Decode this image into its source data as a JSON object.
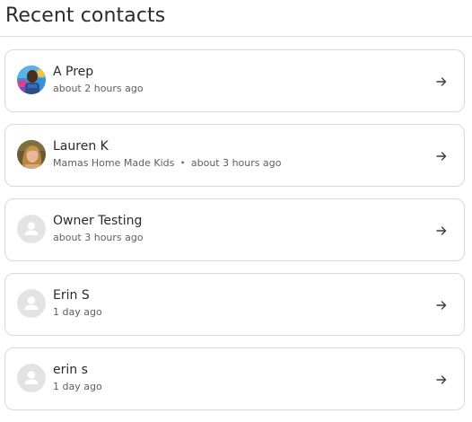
{
  "header": {
    "title": "Recent contacts"
  },
  "contacts": [
    {
      "name": "A Prep",
      "time": "about 2 hours ago",
      "avatar": "photo-avatar-man"
    },
    {
      "name": "Lauren K",
      "company": "Mamas Home Made Kids",
      "separator": "•",
      "time": "about 3 hours ago",
      "avatar": "photo-avatar-woman"
    },
    {
      "name": "Owner Testing",
      "time": "about 3 hours ago",
      "avatar": "default-user-icon"
    },
    {
      "name": "Erin S",
      "time": "1 day ago",
      "avatar": "default-user-icon"
    },
    {
      "name": "erin s",
      "time": "1 day ago",
      "avatar": "default-user-icon"
    }
  ],
  "icons": {
    "row_action": "arrow-right-icon"
  },
  "colors": {
    "border": "#d9d9d9",
    "text_primary": "#2b2b2b",
    "text_secondary": "#5e5e5e",
    "placeholder_avatar_bg": "#e3e3e3",
    "placeholder_avatar_fg": "#ffffff"
  }
}
